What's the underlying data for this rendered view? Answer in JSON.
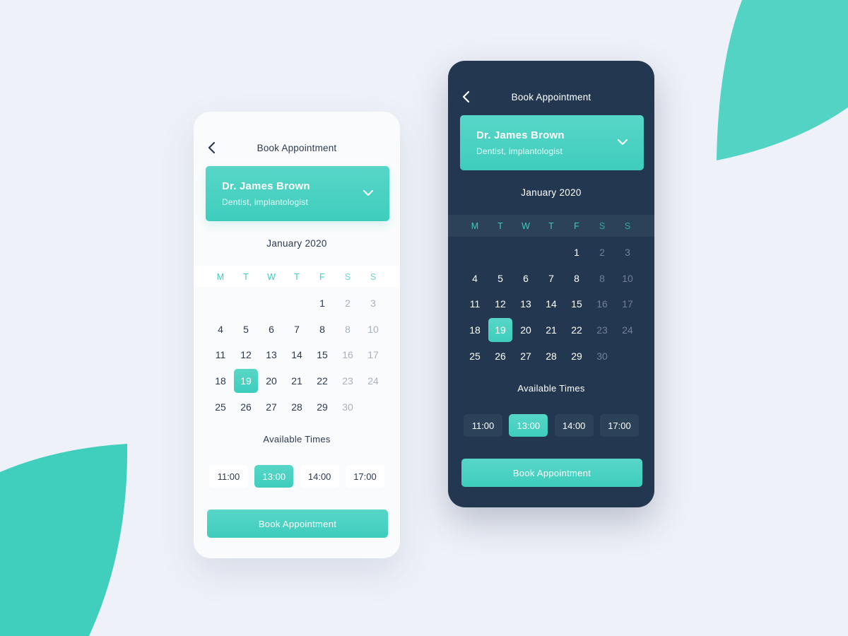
{
  "colors": {
    "accent": "#3ecdbd",
    "accent_light": "#58d6c7",
    "background": "#eef1f8",
    "light_card": "#fafbfc",
    "dark_card": "#233850",
    "text_dark": "#2b3a4f"
  },
  "icons": {
    "back": "chevron-left-icon",
    "dropdown": "chevron-down-icon"
  },
  "phones": [
    {
      "theme": "light",
      "header": {
        "title": "Book Appointment"
      },
      "doctor": {
        "name": "Dr. James Brown",
        "specialty": "Dentist, implantologist"
      },
      "calendar": {
        "month": "January 2020",
        "weekdays": [
          "M",
          "T",
          "W",
          "T",
          "F",
          "S",
          "S"
        ],
        "weeks": [
          [
            "",
            "",
            "",
            "",
            "1",
            "2",
            "3"
          ],
          [
            "4",
            "5",
            "6",
            "7",
            "8",
            "8",
            "10"
          ],
          [
            "11",
            "12",
            "13",
            "14",
            "15",
            "16",
            "17"
          ],
          [
            "18",
            "19",
            "20",
            "21",
            "22",
            "23",
            "24"
          ],
          [
            "25",
            "26",
            "27",
            "28",
            "29",
            "30",
            ""
          ]
        ],
        "selected": "19"
      },
      "times": {
        "label": "Available Times",
        "slots": [
          "11:00",
          "13:00",
          "14:00",
          "17:00"
        ],
        "selected": "13:00"
      },
      "book_label": "Book Appointment"
    },
    {
      "theme": "dark",
      "header": {
        "title": "Book Appointment"
      },
      "doctor": {
        "name": "Dr. James Brown",
        "specialty": "Dentist, implantologist"
      },
      "calendar": {
        "month": "January 2020",
        "weekdays": [
          "M",
          "T",
          "W",
          "T",
          "F",
          "S",
          "S"
        ],
        "weeks": [
          [
            "",
            "",
            "",
            "",
            "1",
            "2",
            "3"
          ],
          [
            "4",
            "5",
            "6",
            "7",
            "8",
            "8",
            "10"
          ],
          [
            "11",
            "12",
            "13",
            "14",
            "15",
            "16",
            "17"
          ],
          [
            "18",
            "19",
            "20",
            "21",
            "22",
            "23",
            "24"
          ],
          [
            "25",
            "26",
            "27",
            "28",
            "29",
            "30",
            ""
          ]
        ],
        "selected": "19"
      },
      "times": {
        "label": "Available Times",
        "slots": [
          "11:00",
          "13:00",
          "14:00",
          "17:00"
        ],
        "selected": "13:00"
      },
      "book_label": "Book Appointment"
    }
  ]
}
